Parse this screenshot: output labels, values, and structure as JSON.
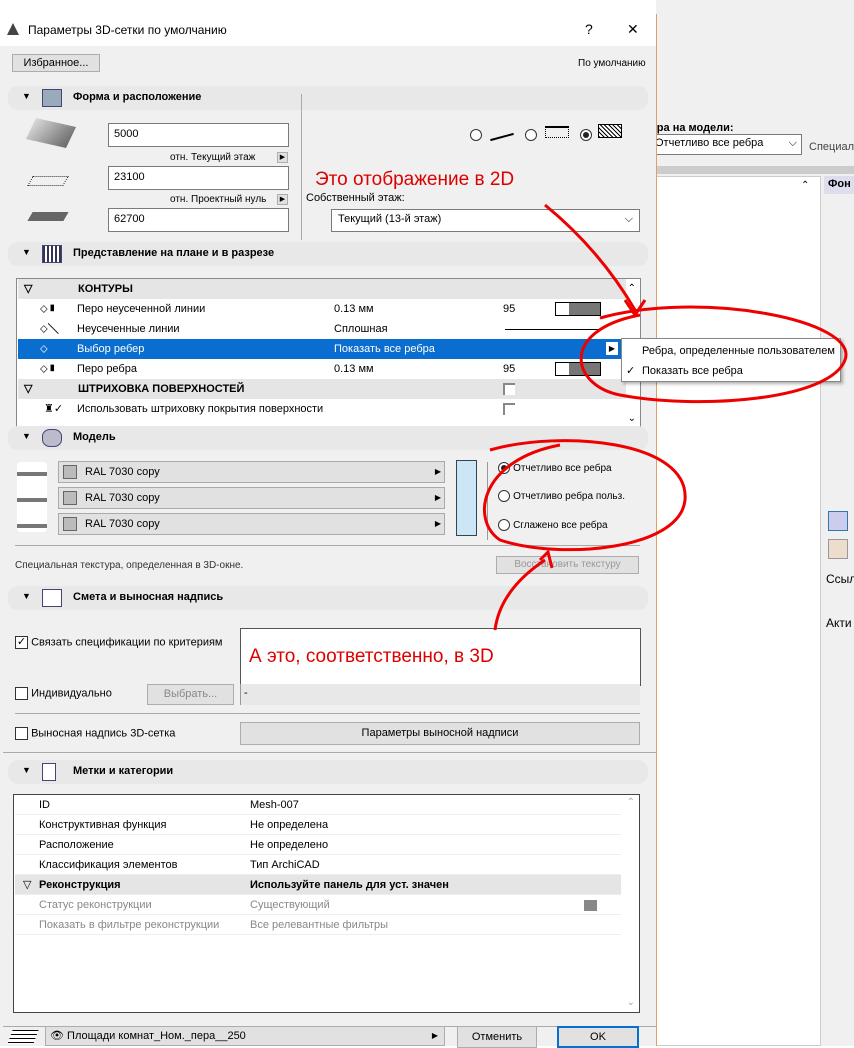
{
  "background": {
    "label": "бра на модели:",
    "select": "Отчетливо все ребра",
    "special": "Специал",
    "panel_header": "Фон",
    "link": "Ссыл",
    "active": "Акти"
  },
  "title": "Параметры 3D-сетки по умолчанию",
  "help": "?",
  "close": "✕",
  "favorites": "Избранное...",
  "default_label": "По умолчанию",
  "shape": {
    "title": "Форма и расположение",
    "thickness": "5000",
    "rel1": "отн. Текущий этаж",
    "offset": "23100",
    "rel2": "отн. Проектный нуль",
    "elevation": "62700",
    "home_story_label": "Собственный этаж:",
    "home_story": "Текущий (13-й этаж)"
  },
  "plan": {
    "title": "Представление на плане и в разрезе",
    "group1": "КОНТУРЫ",
    "rows": [
      {
        "name": "Перо неусеченной линии",
        "value": "0.13 мм",
        "num": "95"
      },
      {
        "name": "Неусеченные линии",
        "value": "Сплошная",
        "num": ""
      },
      {
        "name": "Выбор ребер",
        "value": "Показать все ребра",
        "num": ""
      },
      {
        "name": "Перо ребра",
        "value": "0.13 мм",
        "num": "95"
      }
    ],
    "group2": "ШТРИХОВКА ПОВЕРХНОСТЕЙ",
    "row5": "Использовать штриховку покрытия поверхности"
  },
  "popup": {
    "items": [
      "Ребра, определенные пользователем",
      "Показать все ребра"
    ],
    "check": "✓"
  },
  "model": {
    "title": "Модель",
    "materials": [
      "RAL 7030   copy",
      "RAL 7030   copy",
      "RAL 7030   copy"
    ],
    "edges": [
      "Отчетливо все ребра",
      "Отчетливо ребра польз.",
      "Сглажено все ребра"
    ],
    "note": "Специальная текстура, определенная в 3D-окне.",
    "restore": "Восстановить текстуру"
  },
  "listing": {
    "title": "Смета и выносная надпись",
    "link_label": "Связать спецификации по критериям",
    "individual": "Индивидуально",
    "choose": "Выбрать...",
    "dash": "-",
    "label_cb": "Выносная надпись 3D-сетка",
    "label_params": "Параметры выносной надписи"
  },
  "tags": {
    "title": "Метки и категории",
    "rows": [
      [
        "ID",
        "Mesh-007"
      ],
      [
        "Конструктивная функция",
        "Не определена"
      ],
      [
        "Расположение",
        "Не определено"
      ],
      [
        "Классификация элементов",
        "Тип ArchiCAD"
      ]
    ],
    "group": [
      "Реконструкция",
      "Используйте панель для уст. значен"
    ],
    "sub": [
      [
        "Статус реконструкции",
        "Существующий"
      ],
      [
        "Показать в фильтре реконструкции",
        "Все релевантные фильтры"
      ]
    ]
  },
  "footer": {
    "layer": "Площади комнат_Ном._пера__250",
    "cancel": "Отменить",
    "ok": "OK"
  },
  "annotations": {
    "a2d": "Это отображение в 2D",
    "a3d": "А это, соответственно, в 3D"
  }
}
